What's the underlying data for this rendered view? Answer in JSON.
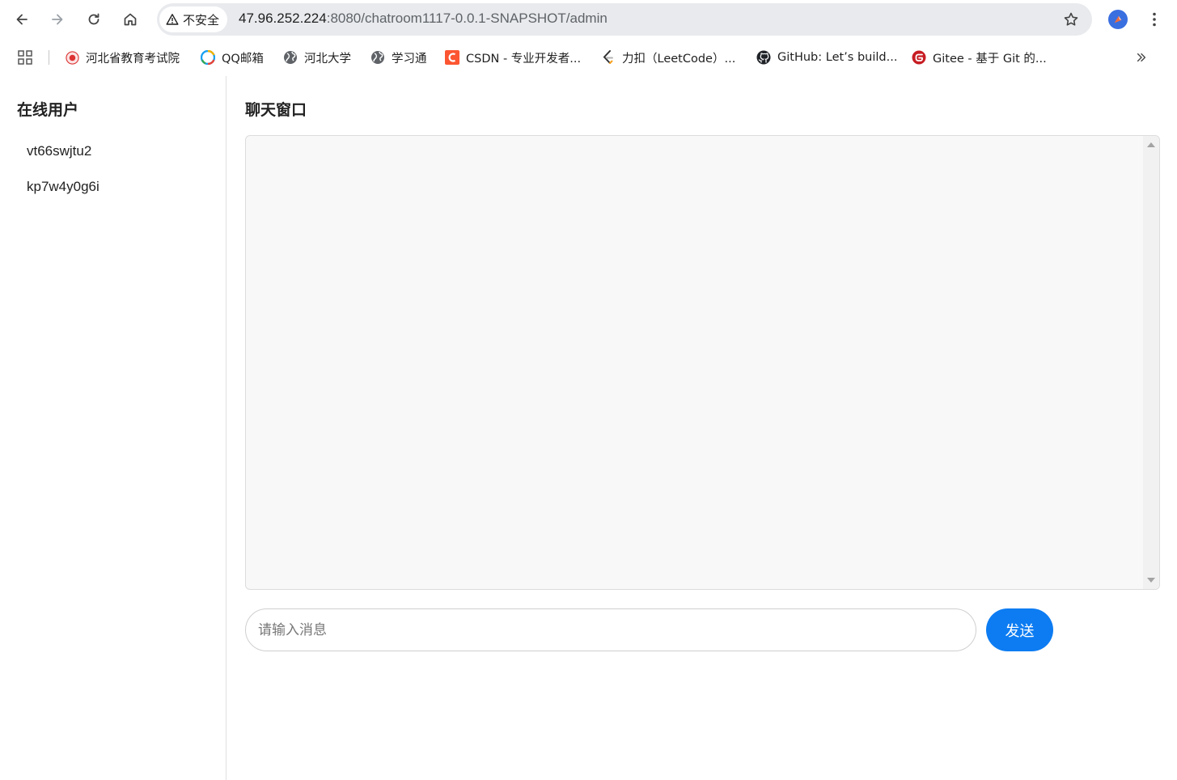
{
  "browser": {
    "security_label": "不安全",
    "url_host": "47.96.252.224",
    "url_path": ":8080/chatroom1117-0.0.1-SNAPSHOT/admin",
    "bookmarks": [
      {
        "label": "河北省教育考试院",
        "icon": "hebei-exam-favicon"
      },
      {
        "label": "QQ邮箱",
        "icon": "qq-mail-favicon"
      },
      {
        "label": "河北大学",
        "icon": "globe-icon"
      },
      {
        "label": "学习通",
        "icon": "globe-icon"
      },
      {
        "label": "CSDN - 专业开发者...",
        "icon": "csdn-favicon"
      },
      {
        "label": "力扣（LeetCode）...",
        "icon": "leetcode-favicon"
      },
      {
        "label": "GitHub: Let’s build...",
        "icon": "github-favicon"
      },
      {
        "label": "Gitee - 基于 Git 的...",
        "icon": "gitee-favicon"
      }
    ]
  },
  "sidebar": {
    "title": "在线用户",
    "users": [
      "vt66swjtu2",
      "kp7w4y0g6i"
    ]
  },
  "chat": {
    "title": "聊天窗口",
    "input_placeholder": "请输入消息",
    "input_value": "",
    "send_label": "发送"
  },
  "colors": {
    "accent": "#0d7cf2",
    "chat_bg": "#f8f8f8"
  }
}
